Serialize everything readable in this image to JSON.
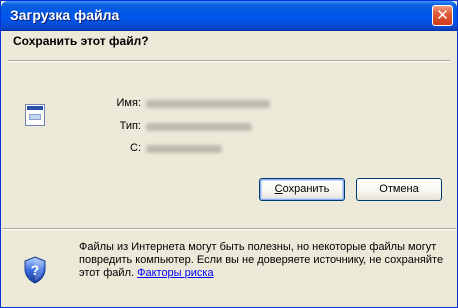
{
  "window": {
    "title": "Загрузка файла",
    "close_glyph": "✕"
  },
  "dialog": {
    "question": "Сохранить этот файл?",
    "file_icon": "document-icon",
    "fields": {
      "name_label": "Имя:",
      "type_label": "Тип:",
      "from_label": "С:"
    },
    "buttons": {
      "save_prefix": "",
      "save_underlined": "С",
      "save_rest": "охранить",
      "cancel": "Отмена"
    }
  },
  "warning": {
    "icon": "security-shield-question-icon",
    "text": "Файлы из Интернета могут быть полезны, но некоторые файлы могут повредить компьютер. Если вы не доверяете источнику, не сохраняйте этот файл. ",
    "link": "Факторы риска"
  },
  "colors": {
    "titlebar": "#0055ea",
    "close_button": "#e05a36",
    "dialog_background": "#ece9d8",
    "link": "#0000ff"
  }
}
